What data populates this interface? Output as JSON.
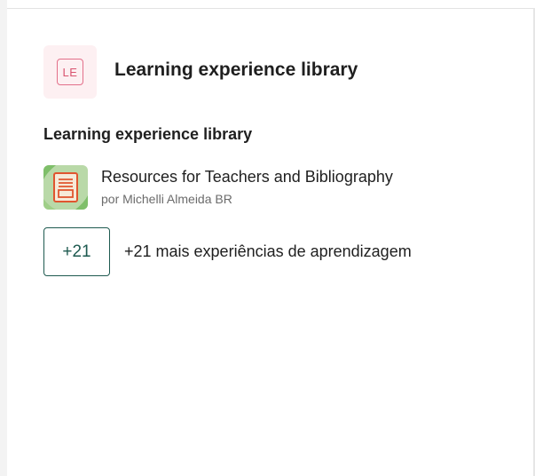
{
  "header": {
    "badge_text": "LE",
    "title": "Learning experience library"
  },
  "section": {
    "heading": "Learning experience library"
  },
  "resource": {
    "title": "Resources for Teachers and Bibliography",
    "author": "por Michelli Almeida BR",
    "icon": "document-icon"
  },
  "more": {
    "button_label": "+21",
    "text": "+21 mais experiências de aprendizagem"
  },
  "colors": {
    "accent_teal": "#1e5a50",
    "badge_pink": "#e36f8a",
    "badge_bg": "#fdf0f2",
    "thumb_green": "#b9d9a8",
    "thumb_orange": "#e0552f"
  }
}
